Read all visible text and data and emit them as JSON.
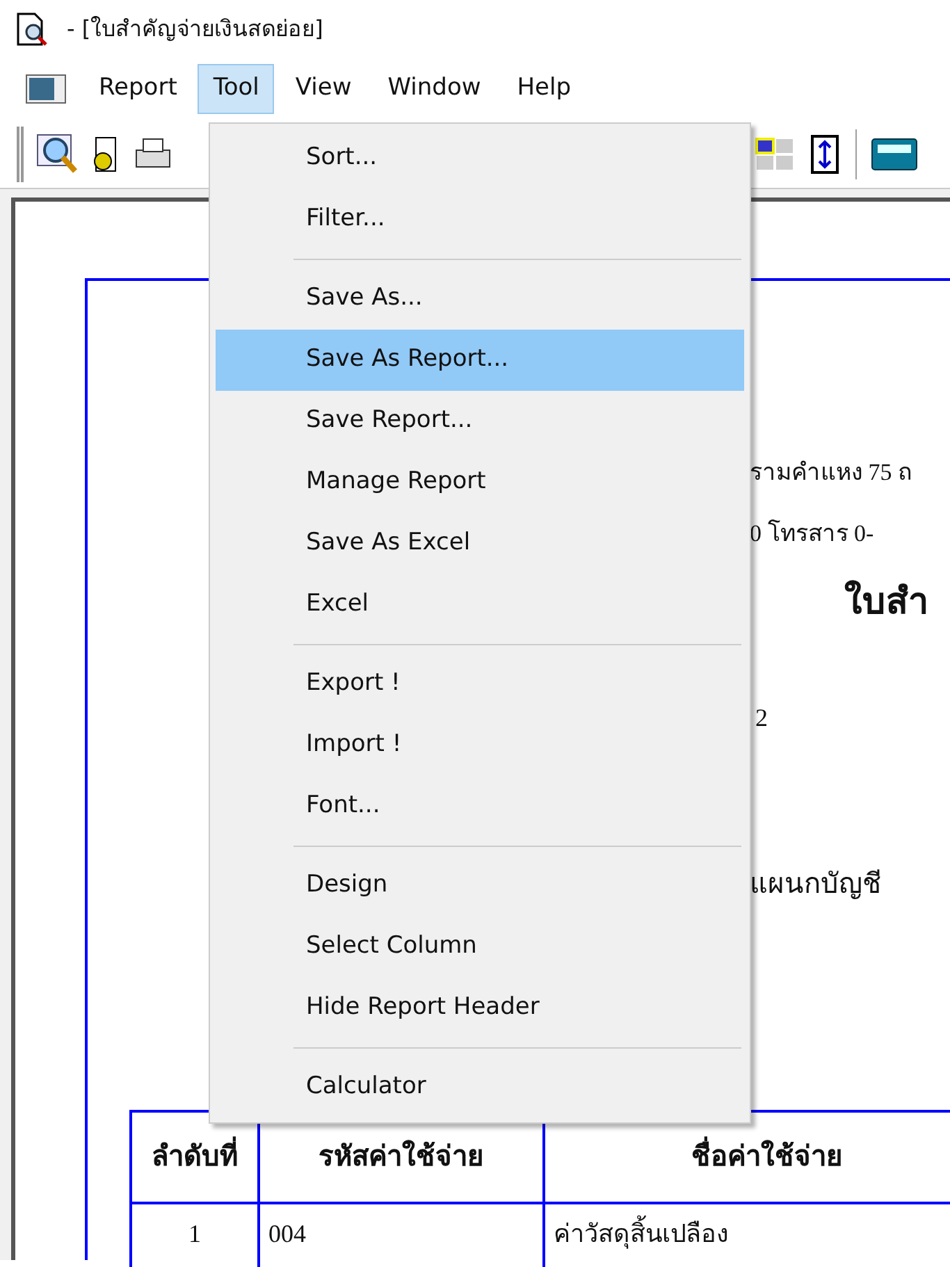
{
  "window": {
    "title": "- [ใบสำคัญจ่ายเงินสดย่อย]"
  },
  "menu_bar": [
    {
      "label": "Report",
      "selected": false
    },
    {
      "label": "Tool",
      "selected": true
    },
    {
      "label": "View",
      "selected": false
    },
    {
      "label": "Window",
      "selected": false
    },
    {
      "label": "Help",
      "selected": false
    }
  ],
  "tool_menu": [
    {
      "kind": "item",
      "label": "Sort...",
      "selected": false
    },
    {
      "kind": "item",
      "label": "Filter...",
      "selected": false
    },
    {
      "kind": "separator"
    },
    {
      "kind": "item",
      "label": "Save As...",
      "selected": false
    },
    {
      "kind": "item",
      "label": "Save As Report...",
      "selected": true
    },
    {
      "kind": "item",
      "label": "Save Report...",
      "selected": false
    },
    {
      "kind": "item",
      "label": "Manage Report",
      "selected": false
    },
    {
      "kind": "item",
      "label": "Save As Excel",
      "selected": false
    },
    {
      "kind": "item",
      "label": "Excel",
      "selected": false
    },
    {
      "kind": "separator"
    },
    {
      "kind": "item",
      "label": "Export !",
      "selected": false
    },
    {
      "kind": "item",
      "label": "Import !",
      "selected": false
    },
    {
      "kind": "item",
      "label": "Font...",
      "selected": false
    },
    {
      "kind": "separator"
    },
    {
      "kind": "item",
      "label": "Design",
      "selected": false
    },
    {
      "kind": "item",
      "label": "Select Column",
      "selected": false
    },
    {
      "kind": "item",
      "label": "Hide Report Header",
      "selected": false
    },
    {
      "kind": "separator"
    },
    {
      "kind": "item",
      "label": "Calculator",
      "selected": false
    }
  ],
  "report": {
    "address_line": "รามคำแหง 75 ถ",
    "phone_line": "0  โทรสาร 0-",
    "title": "ใบสำ",
    "number_line": "2",
    "department_line": "แผนกบัญชี",
    "table": {
      "columns": [
        "ลำดับที่",
        "รหัสค่าใช้จ่าย",
        "ชื่อค่าใช้จ่าย"
      ],
      "rows": [
        [
          "1",
          "004",
          "ค่าวัสดุสิ้นเปลือง"
        ]
      ]
    }
  }
}
